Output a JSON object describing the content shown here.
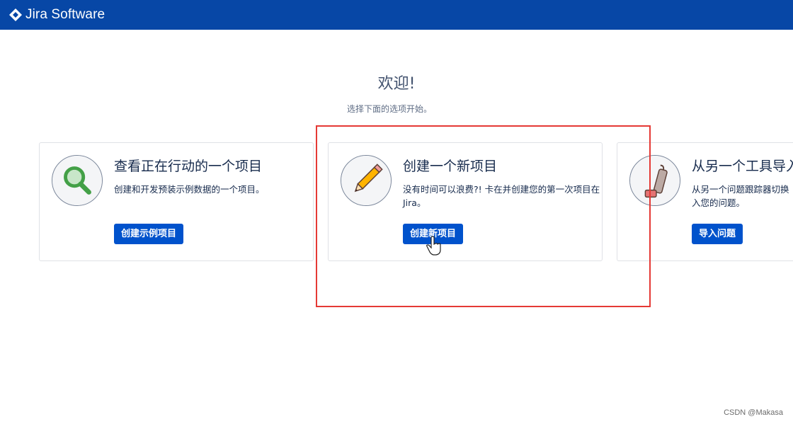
{
  "header": {
    "product_name": "Jira Software",
    "logo_icon": "jira-diamond-icon",
    "bar_color": "#0747a6"
  },
  "welcome": {
    "title": "欢迎!",
    "subtitle": "选择下面的选项开始。"
  },
  "cards": [
    {
      "icon": "magnifier-icon",
      "title": "查看正在行动的一个项目",
      "description": "创建和开发预装示例数据的一个项目。",
      "button_label": "创建示例项目"
    },
    {
      "icon": "pencil-icon",
      "title": "创建一个新项目",
      "description": "没有时间可以浪费?! 卡在并创建您的第一次项目在 Jira。",
      "button_label": "创建新项目"
    },
    {
      "icon": "vacuum-icon",
      "title": "从另一个工具导入",
      "description": "从另一个问题跟踪器切换入您的问题。",
      "button_label": "导入问题"
    }
  ],
  "accent_color": "#0052cc",
  "highlight_color": "#e53935",
  "watermark": "CSDN @Makasa"
}
